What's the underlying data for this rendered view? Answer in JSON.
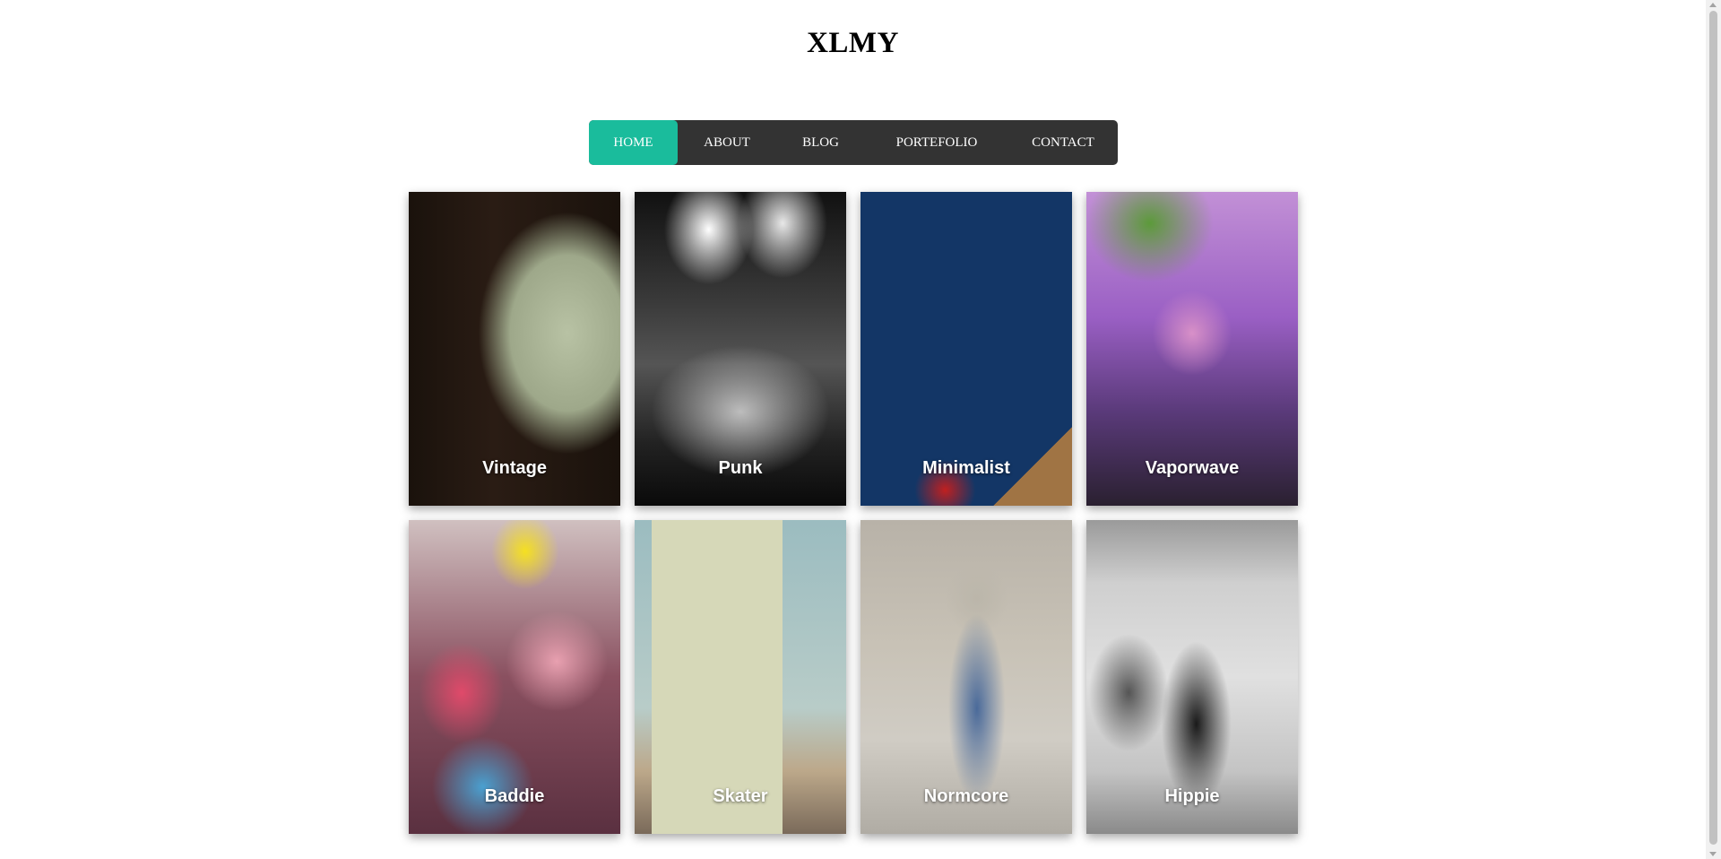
{
  "site": {
    "title": "XLMY"
  },
  "nav": {
    "items": [
      {
        "label": "HOME",
        "active": true
      },
      {
        "label": "ABOUT",
        "active": false
      },
      {
        "label": "BLOG",
        "active": false
      },
      {
        "label": "PORTEFOLIO",
        "active": false
      },
      {
        "label": "CONTACT",
        "active": false
      }
    ],
    "colors": {
      "bar": "#333333",
      "active": "#1abc9c",
      "text": "#ffffff"
    }
  },
  "gallery": {
    "cards": [
      {
        "label": "Vintage"
      },
      {
        "label": "Punk"
      },
      {
        "label": "Minimalist"
      },
      {
        "label": "Vaporwave"
      },
      {
        "label": "Baddie"
      },
      {
        "label": "Skater"
      },
      {
        "label": "Normcore"
      },
      {
        "label": "Hippie"
      }
    ]
  }
}
